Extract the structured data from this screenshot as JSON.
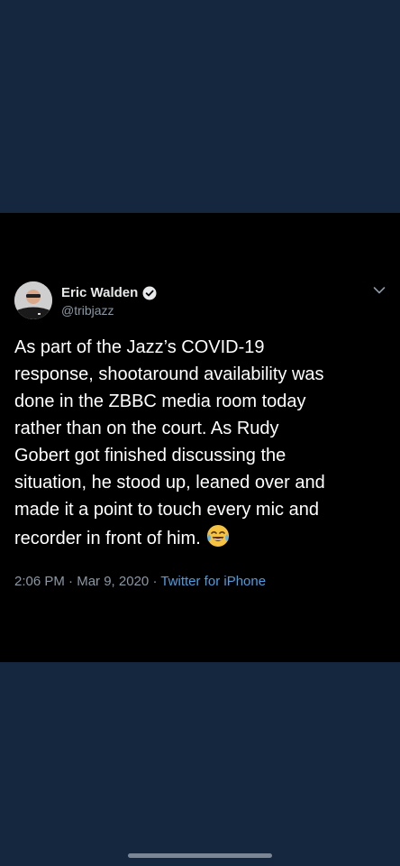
{
  "tweet": {
    "display_name": "Eric Walden",
    "handle": "@tribjazz",
    "text_lines": [
      "As part of the Jazz’s COVID-19",
      "response, shootaround availability was",
      "done in the ZBBC media room today",
      "rather than on the court. As Rudy",
      "Gobert got finished discussing the",
      "situation, he stood up, leaned over and",
      "made it a point to touch every mic and",
      "recorder in front of him."
    ],
    "emoji": "tears-of-joy-emoji",
    "time": "2:06 PM",
    "date": "Mar 9, 2020",
    "separator": "·",
    "source": "Twitter for iPhone"
  },
  "icons": {
    "verified": "verified-badge-icon",
    "more": "chevron-down-icon"
  },
  "colors": {
    "page_background": "#15273f",
    "card_background": "#000000",
    "text_primary": "#ffffff",
    "text_secondary": "#8b98a5",
    "link": "#4d9de0"
  }
}
